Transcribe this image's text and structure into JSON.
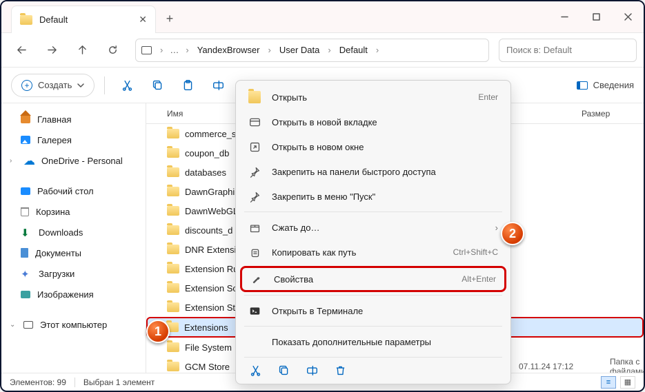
{
  "tab_title": "Default",
  "breadcrumbs": [
    "YandexBrowser",
    "User Data",
    "Default"
  ],
  "search_placeholder": "Поиск в: Default",
  "toolbar": {
    "create": "Создать",
    "details": "Сведения"
  },
  "columns": {
    "name": "Имя",
    "size": "Размер"
  },
  "sidebar": {
    "home": "Главная",
    "gallery": "Галерея",
    "onedrive": "OneDrive - Personal",
    "desktop": "Рабочий стол",
    "recycle": "Корзина",
    "downloads": "Downloads",
    "documents": "Документы",
    "loads": "Загрузки",
    "pictures": "Изображения",
    "thispc": "Этот компьютер"
  },
  "files": [
    "commerce_s",
    "coupon_db",
    "databases",
    "DawnGraphi",
    "DawnWebGL",
    "discounts_d",
    "DNR Extensi",
    "Extension Ru",
    "Extension Sc",
    "Extension St",
    "Extensions",
    "File System",
    "GCM Store"
  ],
  "selected_index": 10,
  "selected_meta": {
    "date": "07.11.24 17:12",
    "type": "Папка с файлами"
  },
  "context_menu": {
    "open": "Открыть",
    "open_tab": "Открыть в новой вкладке",
    "open_win": "Открыть в новом окне",
    "pin_quick": "Закрепить на панели быстрого доступа",
    "pin_start": "Закрепить в меню \"Пуск\"",
    "compress": "Сжать до…",
    "copy_path": "Копировать как путь",
    "properties": "Свойства",
    "terminal": "Открыть в Терминале",
    "show_more": "Показать дополнительные параметры",
    "accel_open": "Enter",
    "accel_copy": "Ctrl+Shift+C",
    "accel_props": "Alt+Enter"
  },
  "status": {
    "count": "Элементов: 99",
    "sel": "Выбран 1 элемент"
  }
}
